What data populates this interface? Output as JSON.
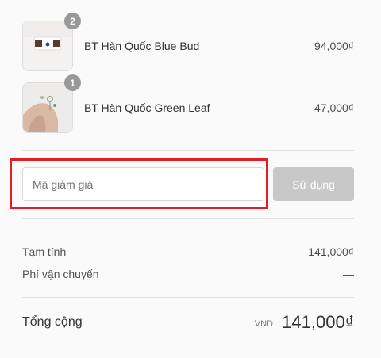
{
  "cart": {
    "items": [
      {
        "quantity": "2",
        "name": "BT Hàn Quốc Blue Bud",
        "price": "94,000₫"
      },
      {
        "quantity": "1",
        "name": "BT Hàn Quốc Green Leaf",
        "price": "47,000₫"
      }
    ]
  },
  "discount": {
    "placeholder": "Mã giảm giá",
    "apply_label": "Sử dụng"
  },
  "summary": {
    "subtotal_label": "Tạm tính",
    "subtotal_value": "141,000₫",
    "shipping_label": "Phí vận chuyển",
    "shipping_value": "—",
    "total_label": "Tổng cộng",
    "total_currency": "VND",
    "total_value": "141,000₫"
  },
  "colors": {
    "highlight": "#e31e24",
    "button_disabled": "#c8c8c8",
    "badge": "#999999"
  }
}
